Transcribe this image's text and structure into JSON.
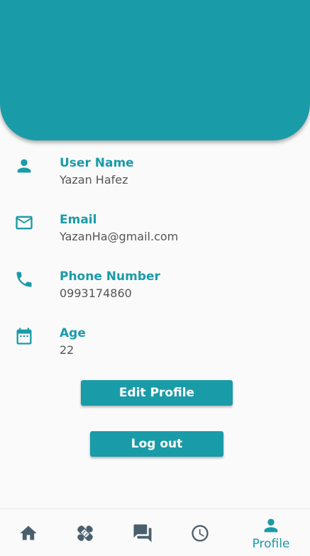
{
  "colors": {
    "primary": "#1a9ba8",
    "nav_icon": "#4a5f6e",
    "value_text": "#555555",
    "background": "#fafafa"
  },
  "profile": {
    "fields": [
      {
        "label": "User Name",
        "value": "Yazan Hafez",
        "icon": "person-icon"
      },
      {
        "label": "Email",
        "value": "YazanHa@gmail.com",
        "icon": "mail-icon"
      },
      {
        "label": "Phone Number",
        "value": "0993174860",
        "icon": "phone-icon"
      },
      {
        "label": "Age",
        "value": "22",
        "icon": "calendar-icon"
      }
    ]
  },
  "actions": {
    "edit_profile_label": "Edit Profile",
    "logout_label": "Log out"
  },
  "bottom_nav": {
    "items": [
      {
        "icon": "home-icon",
        "label": ""
      },
      {
        "icon": "bandage-icon",
        "label": ""
      },
      {
        "icon": "chat-icon",
        "label": ""
      },
      {
        "icon": "clock-icon",
        "label": ""
      },
      {
        "icon": "person-icon",
        "label": "Profile",
        "active": true
      }
    ]
  }
}
